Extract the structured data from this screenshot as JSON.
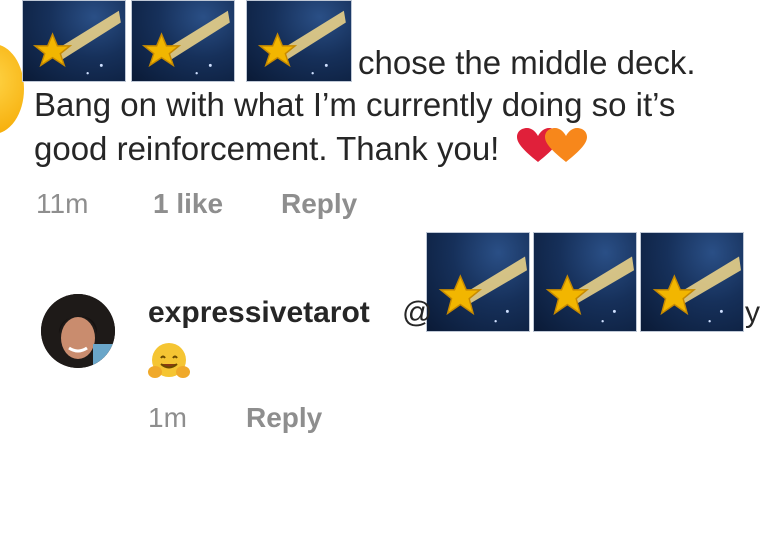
{
  "comment1": {
    "line1_tail": "chose the middle deck.",
    "line2": "Bang on with what I’m currently doing so it’s",
    "line3": "good reinforcement. Thank you!",
    "time": "11m",
    "likes": "1 like",
    "reply_label": "Reply"
  },
  "comment2": {
    "username": "expressivetarot",
    "mention_start": "@",
    "mention_end": "y",
    "time": "1m",
    "reply_label": "Reply"
  },
  "icons": {
    "star_emoji": "shooting-star-icon",
    "hearts": [
      "red-heart-icon",
      "orange-heart-icon"
    ],
    "hug_emoji": "hugging-face-icon"
  },
  "colors": {
    "text": "#262626",
    "muted": "#8e8e8e",
    "tile_bg": "#16305a",
    "star": "#f2b600",
    "red_heart": "#e0203a",
    "orange_heart": "#f7871b"
  }
}
